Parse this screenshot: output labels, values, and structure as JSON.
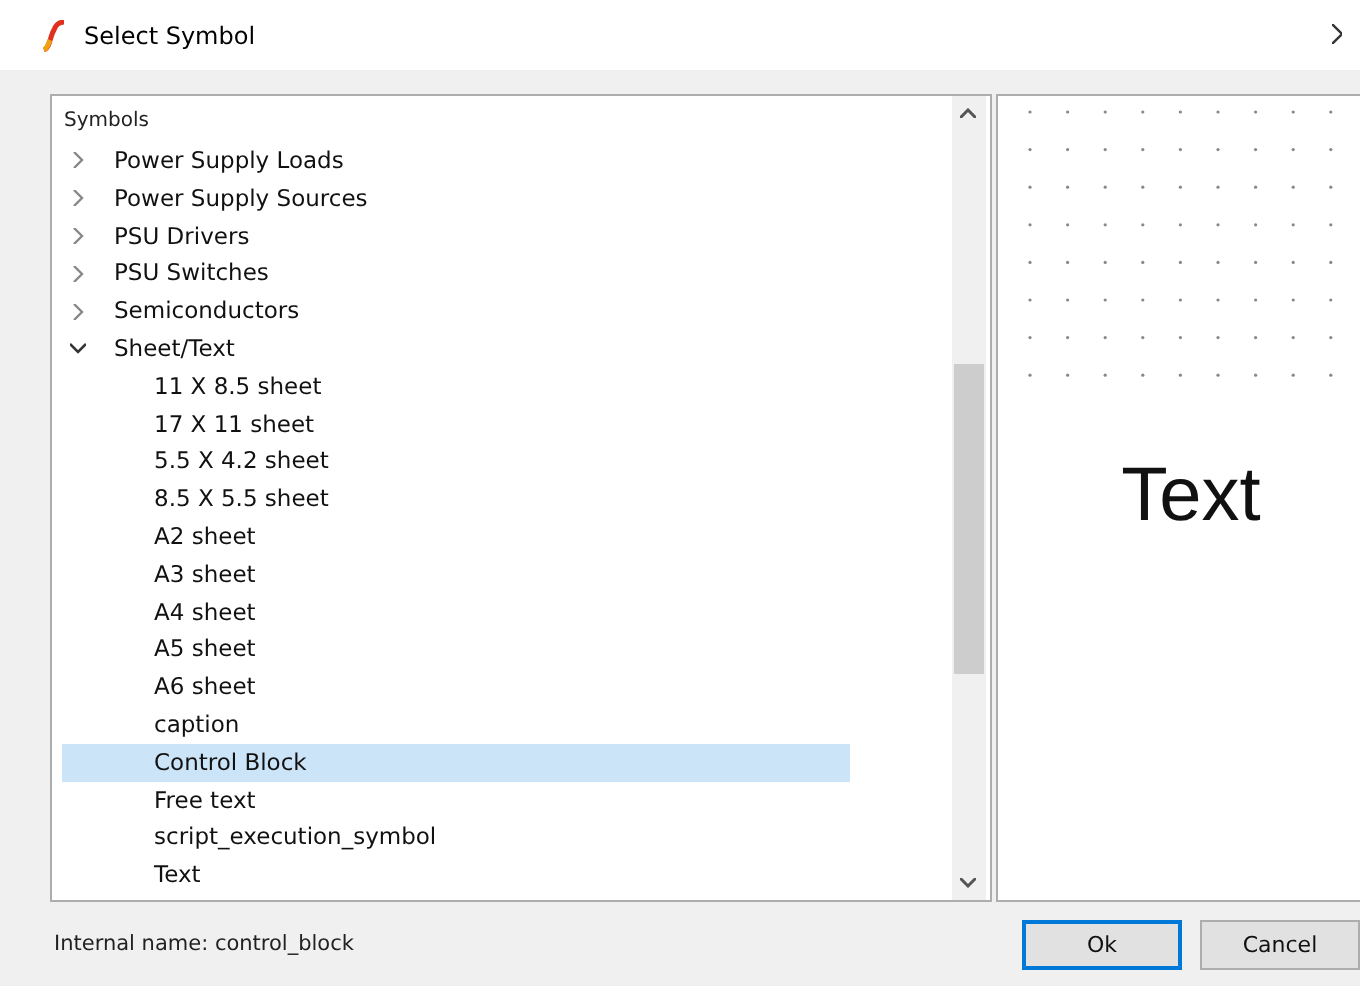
{
  "window": {
    "title": "Select Symbol"
  },
  "tree": {
    "header": "Symbols",
    "items": [
      {
        "label": "Power Supply Loads",
        "expanded": false
      },
      {
        "label": "Power Supply Sources",
        "expanded": false
      },
      {
        "label": "PSU Drivers",
        "expanded": false
      },
      {
        "label": "PSU Switches",
        "expanded": false
      },
      {
        "label": "Semiconductors",
        "expanded": false
      },
      {
        "label": "Sheet/Text",
        "expanded": true,
        "children": [
          {
            "label": "11 X 8.5 sheet",
            "selected": false
          },
          {
            "label": "17 X 11 sheet",
            "selected": false
          },
          {
            "label": "5.5 X 4.2 sheet",
            "selected": false
          },
          {
            "label": "8.5 X 5.5 sheet",
            "selected": false
          },
          {
            "label": "A2 sheet",
            "selected": false
          },
          {
            "label": "A3 sheet",
            "selected": false
          },
          {
            "label": "A4 sheet",
            "selected": false
          },
          {
            "label": "A5 sheet",
            "selected": false
          },
          {
            "label": "A6 sheet",
            "selected": false
          },
          {
            "label": "caption",
            "selected": false
          },
          {
            "label": "Control Block",
            "selected": true
          },
          {
            "label": "Free text",
            "selected": false
          },
          {
            "label": "script_execution_symbol",
            "selected": false
          },
          {
            "label": "Text",
            "selected": false
          }
        ]
      }
    ]
  },
  "preview": {
    "text": "Text"
  },
  "status": "Internal name: control_block",
  "buttons": [
    {
      "label": "Ok",
      "default": true
    },
    {
      "label": "Cancel",
      "default": false
    }
  ]
}
